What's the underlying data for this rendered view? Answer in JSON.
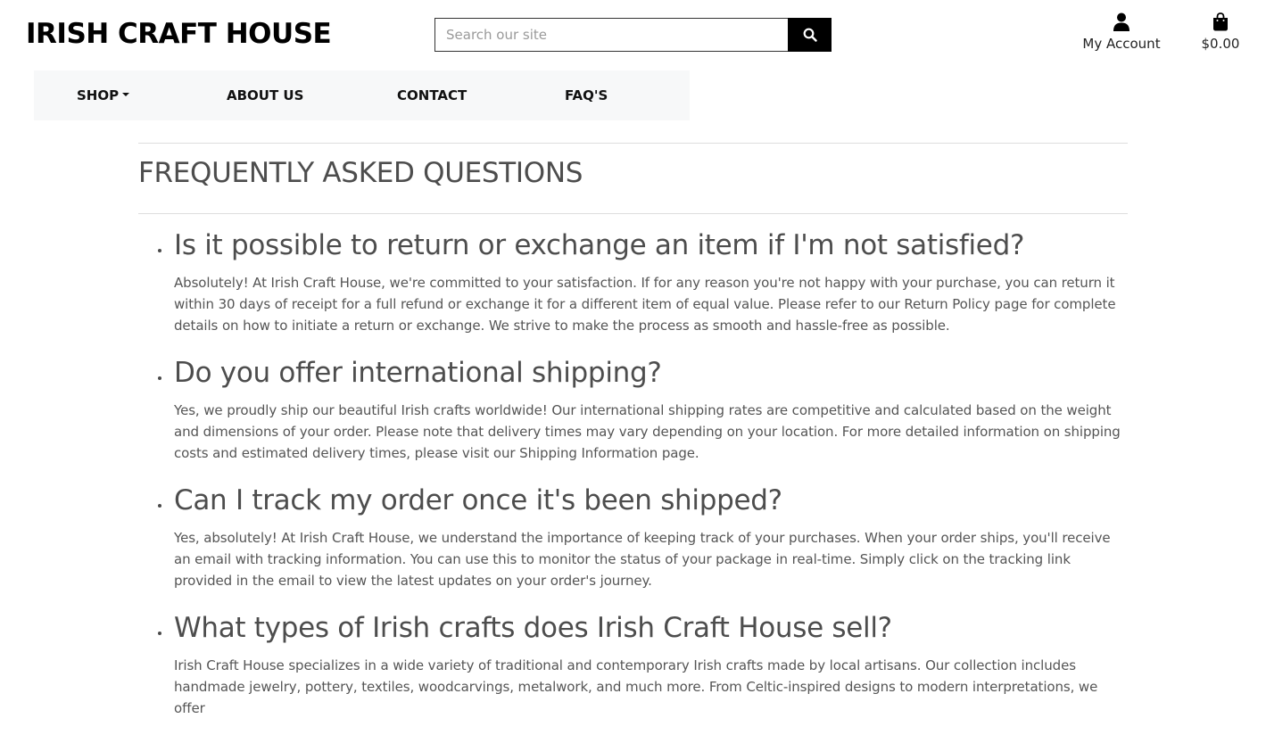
{
  "header": {
    "brand": "IRISH CRAFT HOUSE",
    "search": {
      "placeholder": "Search our site",
      "value": ""
    },
    "account_label": "My Account",
    "cart_total": "$0.00"
  },
  "nav": {
    "items": [
      {
        "label": "SHOP",
        "has_dropdown": true
      },
      {
        "label": "ABOUT US"
      },
      {
        "label": "CONTACT"
      },
      {
        "label": "FAQ'S"
      }
    ]
  },
  "main": {
    "title": "FREQUENTLY ASKED QUESTIONS",
    "faqs": [
      {
        "question": "Is it possible to return or exchange an item if I'm not satisfied?",
        "answer": "Absolutely! At Irish Craft House, we're committed to your satisfaction. If for any reason you're not happy with your purchase, you can return it within 30 days of receipt for a full refund or exchange it for a different item of equal value. Please refer to our Return Policy page for complete details on how to initiate a return or exchange. We strive to make the process as smooth and hassle-free as possible."
      },
      {
        "question": "Do you offer international shipping?",
        "answer": "Yes, we proudly ship our beautiful Irish crafts worldwide! Our international shipping rates are competitive and calculated based on the weight and dimensions of your order. Please note that delivery times may vary depending on your location. For more detailed information on shipping costs and estimated delivery times, please visit our Shipping Information page."
      },
      {
        "question": "Can I track my order once it's been shipped?",
        "answer": "Yes, absolutely! At Irish Craft House, we understand the importance of keeping track of your purchases. When your order ships, you'll receive an email with tracking information. You can use this to monitor the status of your package in real-time. Simply click on the tracking link provided in the email to view the latest updates on your order's journey."
      },
      {
        "question": "What types of Irish crafts does Irish Craft House sell?",
        "answer": "Irish Craft House specializes in a wide variety of traditional and contemporary Irish crafts made by local artisans. Our collection includes handmade jewelry, pottery, textiles, woodcarvings, metalwork, and much more. From Celtic-inspired designs to modern interpretations, we offer"
      }
    ]
  },
  "colors": {
    "nav_background": "#f7f8f9",
    "search_button": "#000000",
    "text": "#4d4d4d"
  },
  "icons": {
    "search": "search-icon",
    "account": "user-icon",
    "cart": "shopping-bag-icon"
  }
}
